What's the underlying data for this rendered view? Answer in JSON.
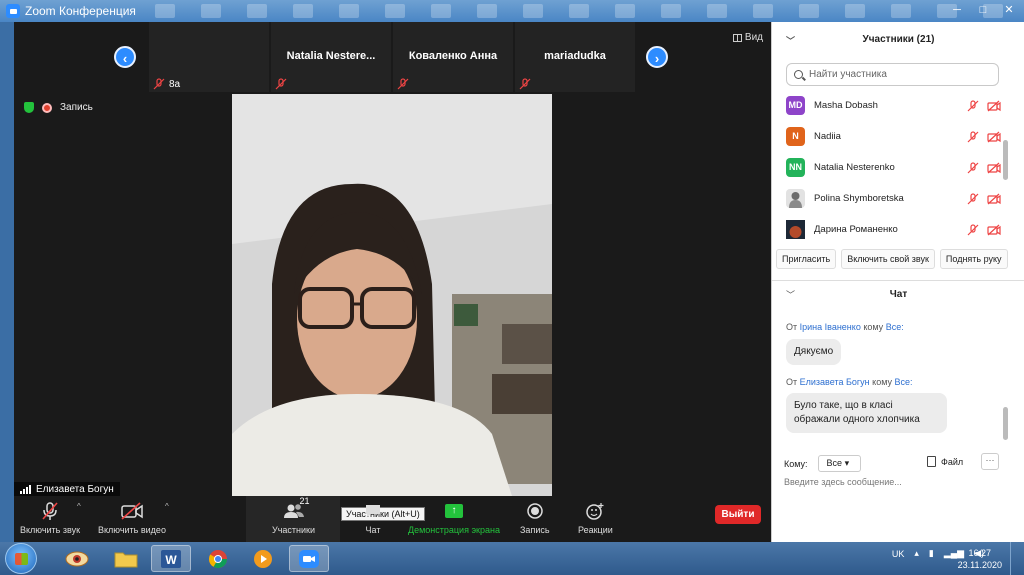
{
  "window": {
    "title": "Zoom Конференция"
  },
  "strip": {
    "tiles": [
      {
        "name": "",
        "label": "8a"
      },
      {
        "name": "Natalia  Nestere...",
        "label": ""
      },
      {
        "name": "Коваленко Анна",
        "label": ""
      },
      {
        "name": "mariadudka",
        "label": ""
      }
    ],
    "prev_icon": "‹",
    "next_icon": "›",
    "view_label": "Вид"
  },
  "status": {
    "recording_label": "Запись"
  },
  "speaker": {
    "name": "Елизавета Богун"
  },
  "toolbar": {
    "mute_label": "Включить звук",
    "video_label": "Включить видео",
    "participants_label": "Участники",
    "participants_count": "21",
    "tooltip": "Участники (Alt+U)",
    "chat_label": "Чат",
    "share_label": "Демонстрация экрана",
    "record_label": "Запись",
    "reactions_label": "Реакции",
    "leave_label": "Выйти"
  },
  "participants_panel": {
    "title": "Участники (21)",
    "search_placeholder": "Найти участника",
    "people": [
      {
        "initials": "MD",
        "name": "Masha Dobash",
        "color": "#8e44c9"
      },
      {
        "initials": "N",
        "name": "Nadiia",
        "color": "#e0641b"
      },
      {
        "initials": "NN",
        "name": "Natalia Nesterenko",
        "color": "#23b35a"
      },
      {
        "initials": "",
        "name": "Polina Shymboretska",
        "color": "#cfcfcf"
      },
      {
        "initials": "",
        "name": "Дарина Романенко",
        "color": "#3a2a22"
      }
    ],
    "buttons": [
      "Пригласить",
      "Включить свой звук",
      "Поднять руку"
    ]
  },
  "chat": {
    "title": "Чат",
    "messages": [
      {
        "from_prefix": "От",
        "from": "Ірина Іваненко",
        "to_prefix": "кому",
        "to": "Все:",
        "text": "Дякуємо"
      },
      {
        "from_prefix": "От",
        "from": "Елизавета Богун",
        "to_prefix": "кому",
        "to": "Все:",
        "text": "Було таке, що в класі ображали одного хлопчика"
      }
    ],
    "to_label": "Кому:",
    "to_value": "Все",
    "file_label": "Файл",
    "more_label": "···",
    "input_placeholder": "Введите здесь сообщение..."
  },
  "taskbar": {
    "language": "UK",
    "time": "16:27",
    "date": "23.11.2020"
  },
  "colors": {
    "accent": "#2d8cff",
    "leave": "#e02828",
    "share": "#23c23c",
    "link": "#2d6fd0"
  }
}
